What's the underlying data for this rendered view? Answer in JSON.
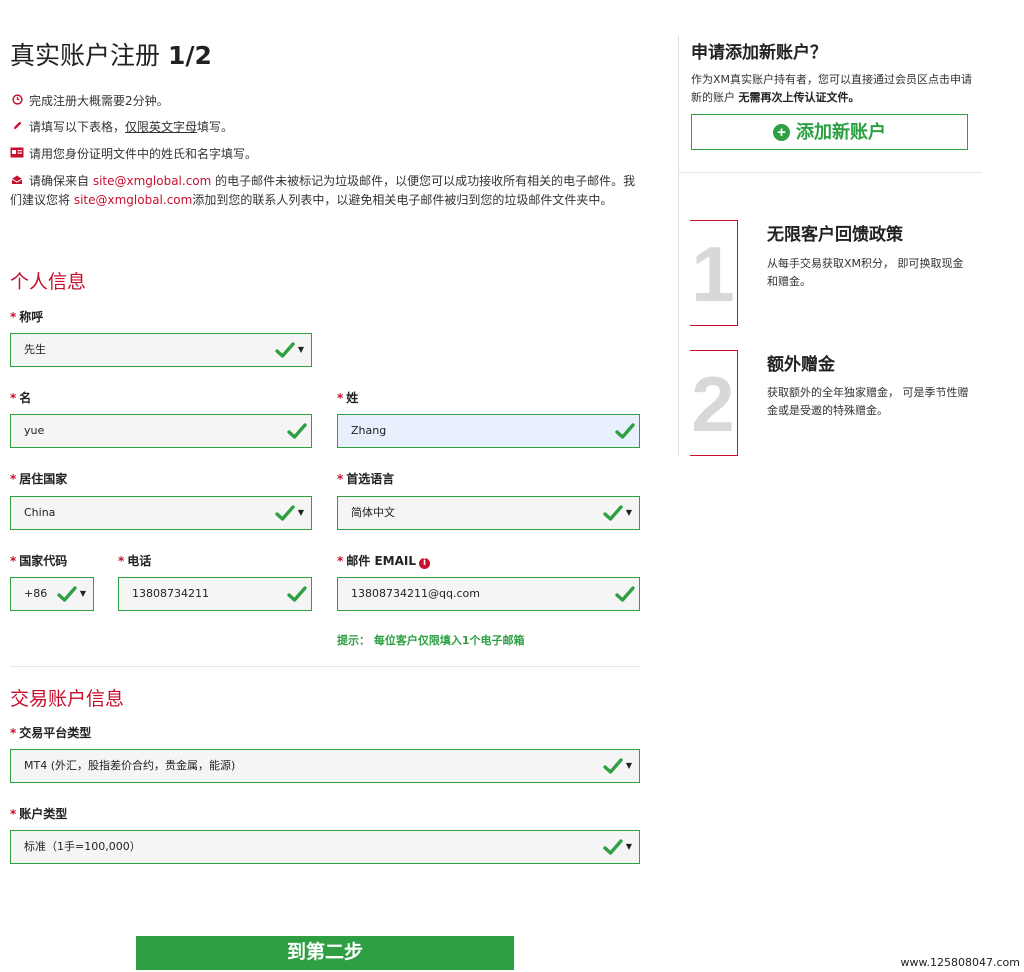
{
  "page": {
    "title_main": "真实账户注册 ",
    "title_step": "1/2"
  },
  "notes": {
    "time": "完成注册大概需要2分钟。",
    "fill_prefix": "请填写以下表格，",
    "fill_underline": "仅限英文字母",
    "fill_suffix": "填写。",
    "id": "请用您身份证明文件中的姓氏和名字填写。",
    "email_p1": "请确保来自 ",
    "email_link1": "site@xmglobal.com",
    "email_p2": " 的电子邮件未被标记为垃圾邮件，以便您可以成功接收所有相关的电子邮件。我们建议您将 ",
    "email_link2": "site@xmglobal.com",
    "email_p3": "添加到您的联系人列表中，以避免相关电子邮件被归到您的垃圾邮件文件夹中。"
  },
  "personal": {
    "section_title": "个人信息",
    "salutation_label": "称呼",
    "salutation_value": "先生",
    "first_name_label": "名",
    "first_name_value": "yue",
    "last_name_label": "姓",
    "last_name_value": "Zhang",
    "country_label": "居住国家",
    "country_value": "China",
    "language_label": "首选语言",
    "language_value": "简体中文",
    "country_code_label": "国家代码",
    "country_code_value": "+86",
    "phone_label": "电话",
    "phone_value": "13808734211",
    "email_label": "邮件 EMAIL",
    "email_info_icon": "i",
    "email_value": "13808734211@qq.com",
    "email_hint": "提示： 每位客户仅限填入1个电子邮箱"
  },
  "trading": {
    "section_title": "交易账户信息",
    "platform_label": "交易平台类型",
    "platform_value": "MT4 (外汇，股指差价合约，贵金属，能源)",
    "account_type_label": "账户类型",
    "account_type_value": "标准（1手=100,000）"
  },
  "next_button": "到第二步",
  "sidebar": {
    "title": "申请添加新账户？",
    "desc_p1": "作为XM真实账户持有者，您可以直接通过会员区点击申请新的账户 ",
    "desc_bold": "无需再次上传认证文件。",
    "add_button": "添加新账户",
    "features": [
      {
        "num": "1",
        "title": "无限客户回馈政策",
        "desc": "从每手交易获取XM积分， 即可换取现金和赠金。"
      },
      {
        "num": "2",
        "title": "额外赠金",
        "desc": "获取额外的全年独家赠金， 可是季节性赠金或是受邀的特殊赠金。"
      }
    ]
  },
  "footer_url": "www.125808047.com",
  "colors": {
    "accent_red": "#c8102e",
    "valid_green": "#2ea043"
  },
  "icons": [
    "clock-icon",
    "pencil-icon",
    "id-card-icon",
    "envelope-icon",
    "checkmark-icon",
    "caret-down-icon",
    "info-icon",
    "plus-circle-icon"
  ]
}
